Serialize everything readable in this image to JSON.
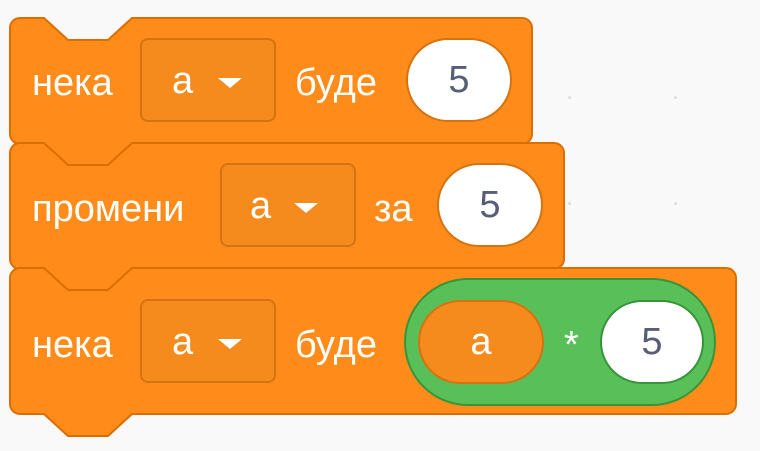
{
  "colors": {
    "workspace_bg": "#f9f9f9",
    "variables_block": "#ff8c1a",
    "variables_border": "#db6e00",
    "operators_block": "#59c059",
    "operators_border": "#389438",
    "input_bg": "#ffffff",
    "input_text": "#575e75",
    "label_text": "#ffffff"
  },
  "blocks": [
    {
      "category": "variables",
      "opcode": "set variable",
      "prefix_label": "нека",
      "variable": "a",
      "dropdown_arrow_icon": "caret-down-icon",
      "suffix_label": "буде",
      "value": "5"
    },
    {
      "category": "variables",
      "opcode": "change variable",
      "prefix_label": "промени",
      "variable": "a",
      "dropdown_arrow_icon": "caret-down-icon",
      "suffix_label": "за",
      "value": "5"
    },
    {
      "category": "variables",
      "opcode": "set variable",
      "prefix_label": "нека",
      "variable": "a",
      "dropdown_arrow_icon": "caret-down-icon",
      "suffix_label": "буде",
      "operator": {
        "category": "operators",
        "left_reporter": "a",
        "symbol": "*",
        "right_value": "5"
      }
    }
  ]
}
